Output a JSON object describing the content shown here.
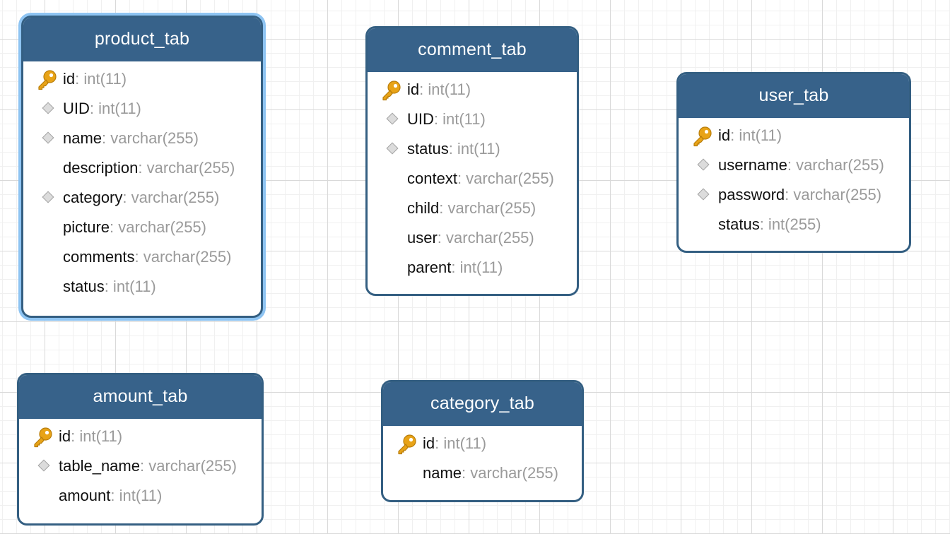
{
  "tables": [
    {
      "id": "product_tab",
      "name": "product_tab",
      "selected": true,
      "fields": [
        {
          "name": "id",
          "type": ": int(11)",
          "icon": "primary-key-icon"
        },
        {
          "name": "UID",
          "type": ": int(11)",
          "icon": "index-diamond-icon"
        },
        {
          "name": "name",
          "type": ": varchar(255)",
          "icon": "index-diamond-icon"
        },
        {
          "name": "description",
          "type": ": varchar(255)",
          "icon": "none"
        },
        {
          "name": "category",
          "type": ": varchar(255)",
          "icon": "index-diamond-icon"
        },
        {
          "name": "picture",
          "type": ": varchar(255)",
          "icon": "none"
        },
        {
          "name": "comments",
          "type": ": varchar(255)",
          "icon": "none"
        },
        {
          "name": "status",
          "type": ": int(11)",
          "icon": "none"
        }
      ]
    },
    {
      "id": "comment_tab",
      "name": "comment_tab",
      "selected": false,
      "fields": [
        {
          "name": "id",
          "type": ": int(11)",
          "icon": "primary-key-icon"
        },
        {
          "name": "UID",
          "type": ": int(11)",
          "icon": "index-diamond-icon"
        },
        {
          "name": "status",
          "type": ": int(11)",
          "icon": "index-diamond-icon"
        },
        {
          "name": "context",
          "type": ": varchar(255)",
          "icon": "none"
        },
        {
          "name": "child",
          "type": ": varchar(255)",
          "icon": "none"
        },
        {
          "name": "user",
          "type": ": varchar(255)",
          "icon": "none"
        },
        {
          "name": "parent",
          "type": ": int(11)",
          "icon": "none"
        }
      ]
    },
    {
      "id": "user_tab",
      "name": "user_tab",
      "selected": false,
      "fields": [
        {
          "name": "id",
          "type": ": int(11)",
          "icon": "primary-key-icon"
        },
        {
          "name": "username",
          "type": ": varchar(255)",
          "icon": "index-diamond-icon"
        },
        {
          "name": "password",
          "type": ": varchar(255)",
          "icon": "index-diamond-icon"
        },
        {
          "name": "status",
          "type": ": int(255)",
          "icon": "none"
        }
      ]
    },
    {
      "id": "amount_tab",
      "name": "amount_tab",
      "selected": false,
      "fields": [
        {
          "name": "id",
          "type": ": int(11)",
          "icon": "primary-key-icon"
        },
        {
          "name": "table_name",
          "type": ": varchar(255)",
          "icon": "index-diamond-icon"
        },
        {
          "name": "amount",
          "type": ": int(11)",
          "icon": "none"
        }
      ]
    },
    {
      "id": "category_tab",
      "name": "category_tab",
      "selected": false,
      "fields": [
        {
          "name": "id",
          "type": ": int(11)",
          "icon": "primary-key-icon"
        },
        {
          "name": "name",
          "type": ": varchar(255)",
          "icon": "none"
        }
      ]
    }
  ],
  "colors": {
    "header": "#37628a",
    "border": "#345f82",
    "selection": "#8ec4f2",
    "key": "#e8a317",
    "type_text": "#9a9a9a"
  }
}
